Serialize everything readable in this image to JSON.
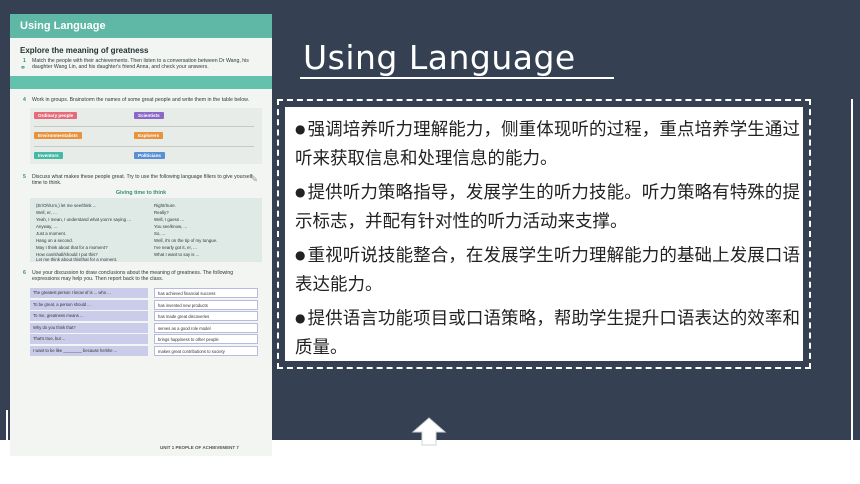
{
  "slide": {
    "title": "Using Language",
    "bullets": [
      "强调培养听力理解能力，侧重体现听的过程，重点培养学生通过听来获取信息和处理信息的能力。",
      "提供听力策略指导，发展学生的听力技能。听力策略有特殊的提示标志，并配有针对性的听力活动来支撑。",
      "重视听说技能整合，在发展学生听力理解能力的基础上发展口语表达能力。",
      "提供语言功能项目或口语策略，帮助学生提升口语表达的效率和质量。"
    ]
  },
  "textbook": {
    "header": "Using Language",
    "section_title": "Explore the meaning of greatness",
    "task1": {
      "num": "1",
      "text": "Match the people with their achievements. Then listen to a conversation between Dr Wang, his daughter Wang Lin, and his daughter's friend Anna, and check your answers."
    },
    "task4": {
      "num": "4",
      "text": "Work in groups. Brainstorm the names of some great people and write them in the table below."
    },
    "tags": [
      "Ordinary people",
      "Scientists",
      "Environmentalists",
      "Explorers",
      "Inventors",
      "Politicians"
    ],
    "task5": {
      "num": "5",
      "text": "Discuss what makes these people great. Try to use the following language fillers to give yourself time to think."
    },
    "giving_time": "Giving time to think",
    "fillers_left": [
      "(Er/Oh/Um,) let me see/think ...",
      "Well, er, ...",
      "Yeah, I mean, I understand what you're saying ...",
      "Anyway, ...",
      "Just a moment.",
      "Hang on a second.",
      "May I think about that for a moment?",
      "How can/shall/should I put this?",
      "Let me think about this/that for a moment."
    ],
    "fillers_right": [
      "Right/Sure.",
      "Really?",
      "Well, I guess ...",
      "You see/know, ...",
      "So, ...",
      "Well, it's on the tip of my tongue.",
      "I've nearly got it, er, ...",
      "What I want to say is ..."
    ],
    "task6": {
      "num": "6",
      "text": "Use your discussion to draw conclusions about the meaning of greatness. The following expressions may help you. Then report back to the class."
    },
    "expr_left": [
      "The greatest person I know of is ... who ...",
      "To be great, a person should ...",
      "To me, greatness means ...",
      "Why do you think that?",
      "That's true, but ...",
      "I want to be like ________ because he/she ..."
    ],
    "expr_right": [
      "has achieved financial success",
      "has invented new products",
      "has made great discoveries",
      "serves as a good role model",
      "brings happiness to other people",
      "makes great contributions to society"
    ],
    "footer": "UNIT 1  PEOPLE OF ACHIEVEMENT  7"
  },
  "colors": {
    "background": "#354152",
    "header_teal": "#5fb7a5",
    "expr_purple": "#c9cdea"
  }
}
